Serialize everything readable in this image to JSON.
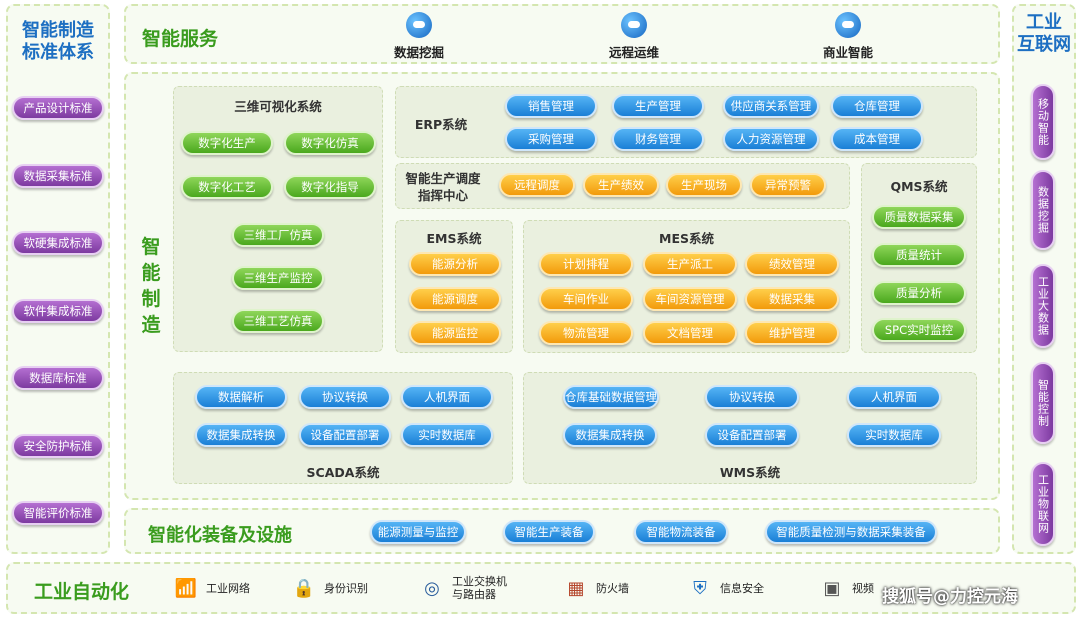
{
  "left_column": {
    "title": "智能制造\n标准体系",
    "items": [
      "产品设计标准",
      "数据采集标准",
      "软硬集成标准",
      "软件集成标准",
      "数据库标准",
      "安全防护标准",
      "智能评价标准"
    ]
  },
  "right_column": {
    "title": "工业\n互联网",
    "items": [
      "移动智能",
      "数据挖掘",
      "工业大数据",
      "智能控制",
      "工业物联网"
    ]
  },
  "smart_service": {
    "title": "智能服务",
    "items": [
      "数据挖掘",
      "远程运维",
      "商业智能"
    ]
  },
  "smart_manufacturing": {
    "title": "智能制造",
    "viz3d": {
      "title": "三维可视化系统",
      "row_items": [
        "数字化生产",
        "数字化仿真",
        "数字化工艺",
        "数字化指导"
      ],
      "col_items": [
        "三维工厂仿真",
        "三维生产监控",
        "三维工艺仿真"
      ]
    },
    "erp": {
      "title": "ERP系统",
      "items": [
        "销售管理",
        "生产管理",
        "供应商关系管理",
        "仓库管理",
        "采购管理",
        "财务管理",
        "人力资源管理",
        "成本管理"
      ]
    },
    "dispatch": {
      "title": "智能生产调度指挥中心",
      "items": [
        "远程调度",
        "生产绩效",
        "生产现场",
        "异常预警"
      ]
    },
    "qms": {
      "title": "QMS系统",
      "items": [
        "质量数据采集",
        "质量统计",
        "质量分析",
        "SPC实时监控"
      ]
    },
    "ems": {
      "title": "EMS系统",
      "items": [
        "能源分析",
        "能源调度",
        "能源监控"
      ]
    },
    "mes": {
      "title": "MES系统",
      "items": [
        "计划排程",
        "生产派工",
        "绩效管理",
        "车间作业",
        "车间资源管理",
        "数据采集",
        "物流管理",
        "文档管理",
        "维护管理"
      ]
    },
    "scada": {
      "title": "SCADA系统",
      "items": [
        "数据解析",
        "协议转换",
        "人机界面",
        "数据集成转换",
        "设备配置部署",
        "实时数据库"
      ]
    },
    "wms": {
      "title": "WMS系统",
      "items": [
        "仓库基础数据管理",
        "协议转换",
        "人机界面",
        "数据集成转换",
        "设备配置部署",
        "实时数据库"
      ]
    }
  },
  "equipment": {
    "title": "智能化装备及设施",
    "items": [
      "能源测量与监控",
      "智能生产装备",
      "智能物流装备",
      "智能质量检测与数据采集装备"
    ]
  },
  "automation": {
    "title": "工业自动化",
    "items": [
      {
        "label": "工业网络",
        "icon": "wifi-icon"
      },
      {
        "label": "身份识别",
        "icon": "lock-icon"
      },
      {
        "label": "工业交换机\n与路由器",
        "icon": "router-icon"
      },
      {
        "label": "防火墙",
        "icon": "firewall-icon"
      },
      {
        "label": "信息安全",
        "icon": "shield-icon"
      },
      {
        "label": "视频",
        "icon": "camera-icon"
      }
    ]
  },
  "watermark": "搜狐号@力控元海"
}
